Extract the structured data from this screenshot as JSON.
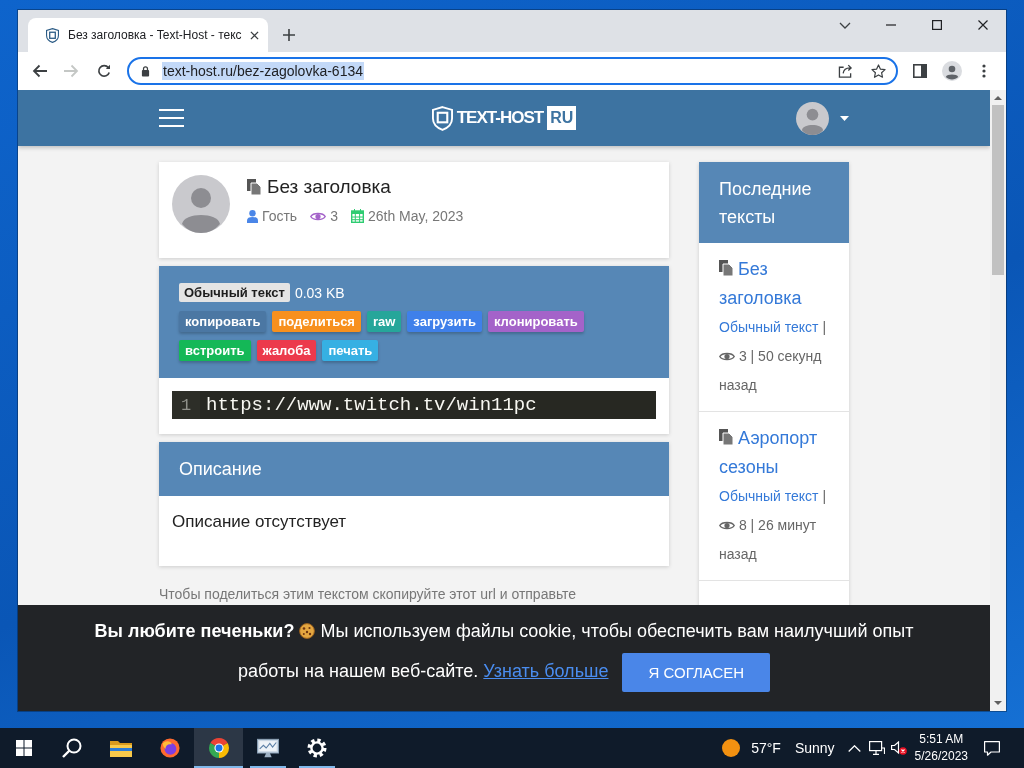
{
  "browser": {
    "tabs": [
      {
        "title": "Без заголовка - Text-Host - текс",
        "selected": true
      }
    ],
    "forward_disabled": true,
    "address": {
      "url": "text-host.ru/bez-zagolovka-6134",
      "highlighted": true
    }
  },
  "site": {
    "logo": {
      "name": "TEXT-HOST",
      "badge": "RU"
    }
  },
  "paste": {
    "title": "Без заголовка",
    "author": "Гость",
    "views": "3",
    "date": "26th May, 2023",
    "syntax": "Обычный текст",
    "size": "0.03 KB",
    "actions": [
      {
        "label": "копировать",
        "color": "#4b77a3"
      },
      {
        "label": "поделиться",
        "color": "#f7901e"
      },
      {
        "label": "raw",
        "color": "#26a69a"
      },
      {
        "label": "загрузить",
        "color": "#3f80ea"
      },
      {
        "label": "клонировать",
        "color": "#a463c9"
      },
      {
        "label": "встроить",
        "color": "#14b857"
      },
      {
        "label": "жалоба",
        "color": "#ec3a4c"
      },
      {
        "label": "печать",
        "color": "#36b0e3"
      }
    ],
    "lines": [
      {
        "number": "1",
        "text": "https://www.twitch.tv/win11pc"
      }
    ]
  },
  "description": {
    "title": "Описание",
    "text": "Описание отсутствует"
  },
  "share_hint": "Чтобы поделиться этим текстом скопируйте этот url и отправьте",
  "sidebar": {
    "title": "Последние тексты",
    "items": [
      {
        "title": "Без заголовка",
        "syntax": "Обычный текст",
        "separator": "|",
        "stats": "3 | 50 секунд назад"
      },
      {
        "title": "Аэропорт сезоны",
        "syntax": "Обычный текст",
        "separator": "|",
        "stats": "8 | 26 минут назад"
      }
    ]
  },
  "cookie_banner": {
    "question": "Вы любите печеньки?",
    "message": "Мы используем файлы cookie, чтобы обеспечить вам наилучший опыт работы на нашем веб-сайте.",
    "link": "Узнать больше",
    "button": "Я СОГЛАСЕН"
  },
  "taskbar": {
    "apps": [
      {
        "kind": "folder",
        "running": false,
        "selected": false
      },
      {
        "kind": "firefox",
        "running": false,
        "selected": false
      },
      {
        "kind": "chrome",
        "running": true,
        "selected": true
      },
      {
        "kind": "monitor",
        "running": true,
        "selected": false
      },
      {
        "kind": "gear",
        "running": true,
        "selected": false
      }
    ],
    "weather": {
      "temperature": "57°F",
      "condition": "Sunny"
    },
    "volume_muted": true,
    "time": "5:51 AM",
    "date": "5/26/2023"
  }
}
